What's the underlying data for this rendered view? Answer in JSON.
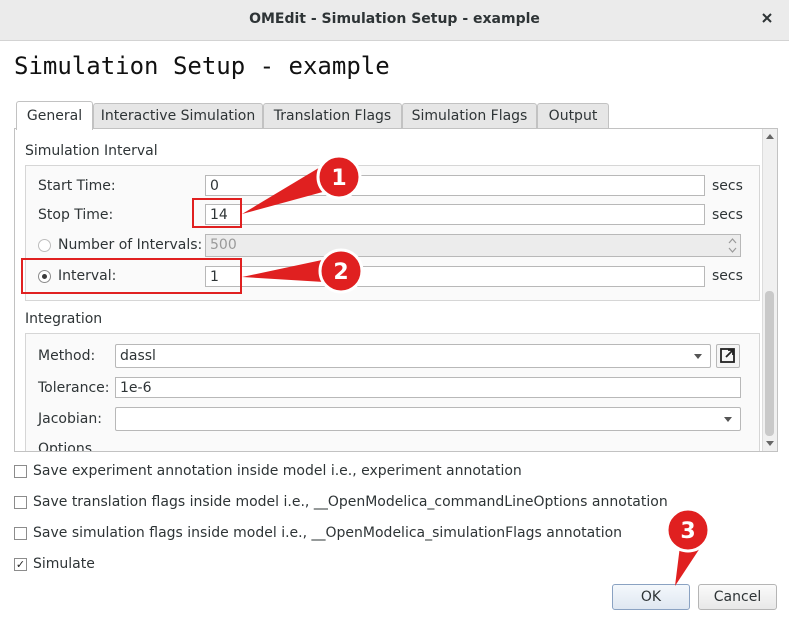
{
  "window": {
    "title": "OMEdit - Simulation Setup - example",
    "close_icon": "close-icon"
  },
  "heading": "Simulation Setup - example",
  "tabs": [
    {
      "label": "General",
      "active": true
    },
    {
      "label": "Interactive Simulation",
      "active": false
    },
    {
      "label": "Translation Flags",
      "active": false
    },
    {
      "label": "Simulation Flags",
      "active": false
    },
    {
      "label": "Output",
      "active": false
    }
  ],
  "simulation_interval": {
    "title": "Simulation Interval",
    "start_time": {
      "label": "Start Time:",
      "value": "0",
      "unit": "secs"
    },
    "stop_time": {
      "label": "Stop Time:",
      "value": "14",
      "unit": "secs"
    },
    "number_of_intervals": {
      "label": "Number of Intervals:",
      "value": "500",
      "selected": false
    },
    "interval": {
      "label": "Interval:",
      "value": "1",
      "unit": "secs",
      "selected": true
    }
  },
  "integration": {
    "title": "Integration",
    "method": {
      "label": "Method:",
      "value": "dassl"
    },
    "tolerance": {
      "label": "Tolerance:",
      "value": "1e-6"
    },
    "jacobian": {
      "label": "Jacobian:",
      "value": ""
    },
    "options_label": "Options"
  },
  "checkboxes": [
    {
      "label": "Save experiment annotation inside model i.e., experiment annotation",
      "checked": false
    },
    {
      "label": "Save translation flags inside model i.e., __OpenModelica_commandLineOptions annotation",
      "checked": false
    },
    {
      "label": "Save simulation flags inside model i.e., __OpenModelica_simulationFlags annotation",
      "checked": false
    },
    {
      "label": "Simulate",
      "checked": true
    }
  ],
  "checkmark": "✓",
  "buttons": {
    "ok": "OK",
    "cancel": "Cancel"
  },
  "annotations": {
    "callout_1": "1",
    "callout_2": "2",
    "callout_3": "3",
    "color": "#e02020"
  }
}
